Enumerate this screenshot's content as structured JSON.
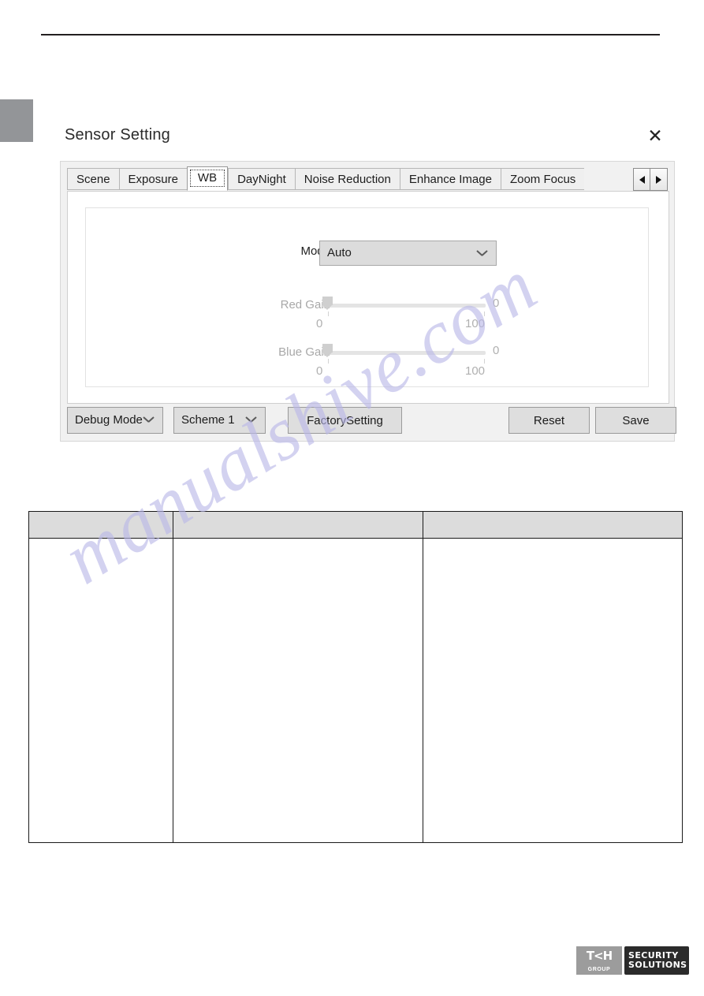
{
  "page": {
    "rule_present": true,
    "side_marker_present": true,
    "watermark": "manualshive.com"
  },
  "dialog": {
    "title": "Sensor Setting",
    "close_icon": "close-icon",
    "tabs": [
      {
        "label": "Scene",
        "active": false
      },
      {
        "label": "Exposure",
        "active": false
      },
      {
        "label": "WB",
        "active": true
      },
      {
        "label": "DayNight",
        "active": false
      },
      {
        "label": "Noise Reduction",
        "active": false
      },
      {
        "label": "Enhance Image",
        "active": false
      },
      {
        "label": "Zoom Focus",
        "active": false
      }
    ],
    "tab_nav": {
      "prev_icon": "chevron-left-icon",
      "next_icon": "chevron-right-icon"
    },
    "wb_panel": {
      "mode": {
        "label": "Mode",
        "value": "Auto",
        "chevron_icon": "chevron-down-icon"
      },
      "sliders": [
        {
          "label": "Red Gain",
          "value": "0",
          "scale_min": "0",
          "scale_max": "100",
          "disabled": true
        },
        {
          "label": "Blue Gain",
          "value": "0",
          "scale_min": "0",
          "scale_max": "100",
          "disabled": true
        }
      ]
    },
    "bottom_bar": {
      "debug_mode": "Debug Mode",
      "scheme": "Scheme 1",
      "factory_setting": "FactorySetting",
      "reset": "Reset",
      "save": "Save"
    }
  },
  "table": {
    "columns": [
      "",
      "",
      ""
    ],
    "header": [
      "",
      "",
      ""
    ],
    "rows": [
      [
        "",
        "",
        ""
      ]
    ]
  },
  "footer": {
    "logo_mark": "T<H",
    "logo_group": "GROUP",
    "logo_line1": "SECURITY",
    "logo_line2": "SOLUTIONS"
  },
  "colors": {
    "dialog_bg": "#f1f1f1",
    "panel_bg": "#ffffff",
    "button_bg": "#dedede",
    "table_header": "#dcdcdc",
    "marker": "#939598",
    "watermark": "#b9b7e8"
  }
}
